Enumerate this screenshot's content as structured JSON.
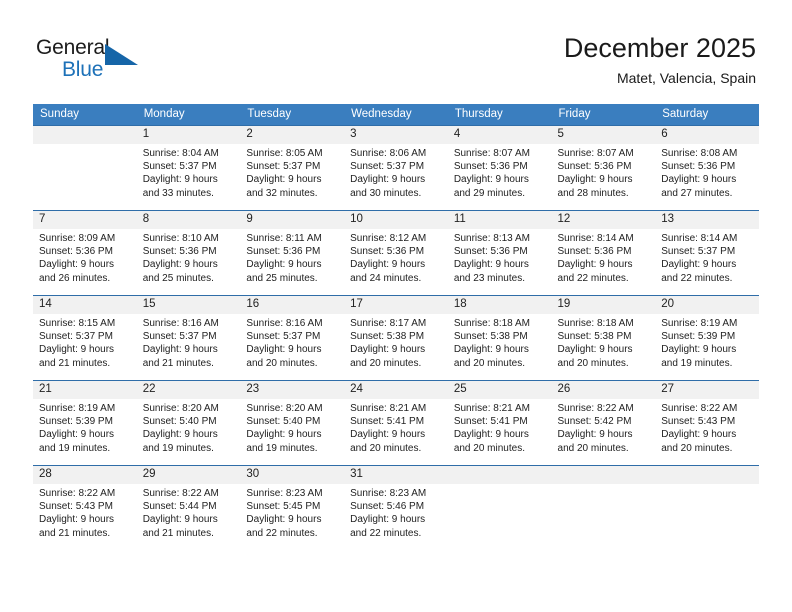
{
  "brand": {
    "name_part1": "General",
    "name_part2": "Blue",
    "logo_icon": "triangle-logo-icon"
  },
  "header": {
    "title": "December 2025",
    "subtitle": "Matet, Valencia, Spain"
  },
  "colors": {
    "header_blue": "#3a7ebf",
    "rule_blue": "#2f6da8",
    "daynum_bg": "#f1f1f1",
    "brand_blue": "#1d71b8"
  },
  "calendar": {
    "weekday_headers": [
      "Sunday",
      "Monday",
      "Tuesday",
      "Wednesday",
      "Thursday",
      "Friday",
      "Saturday"
    ],
    "weeks": [
      [
        {
          "day": "",
          "sunrise": "",
          "sunset": "",
          "daylight_line1": "",
          "daylight_line2": ""
        },
        {
          "day": "1",
          "sunrise": "Sunrise: 8:04 AM",
          "sunset": "Sunset: 5:37 PM",
          "daylight_line1": "Daylight: 9 hours",
          "daylight_line2": "and 33 minutes."
        },
        {
          "day": "2",
          "sunrise": "Sunrise: 8:05 AM",
          "sunset": "Sunset: 5:37 PM",
          "daylight_line1": "Daylight: 9 hours",
          "daylight_line2": "and 32 minutes."
        },
        {
          "day": "3",
          "sunrise": "Sunrise: 8:06 AM",
          "sunset": "Sunset: 5:37 PM",
          "daylight_line1": "Daylight: 9 hours",
          "daylight_line2": "and 30 minutes."
        },
        {
          "day": "4",
          "sunrise": "Sunrise: 8:07 AM",
          "sunset": "Sunset: 5:36 PM",
          "daylight_line1": "Daylight: 9 hours",
          "daylight_line2": "and 29 minutes."
        },
        {
          "day": "5",
          "sunrise": "Sunrise: 8:07 AM",
          "sunset": "Sunset: 5:36 PM",
          "daylight_line1": "Daylight: 9 hours",
          "daylight_line2": "and 28 minutes."
        },
        {
          "day": "6",
          "sunrise": "Sunrise: 8:08 AM",
          "sunset": "Sunset: 5:36 PM",
          "daylight_line1": "Daylight: 9 hours",
          "daylight_line2": "and 27 minutes."
        }
      ],
      [
        {
          "day": "7",
          "sunrise": "Sunrise: 8:09 AM",
          "sunset": "Sunset: 5:36 PM",
          "daylight_line1": "Daylight: 9 hours",
          "daylight_line2": "and 26 minutes."
        },
        {
          "day": "8",
          "sunrise": "Sunrise: 8:10 AM",
          "sunset": "Sunset: 5:36 PM",
          "daylight_line1": "Daylight: 9 hours",
          "daylight_line2": "and 25 minutes."
        },
        {
          "day": "9",
          "sunrise": "Sunrise: 8:11 AM",
          "sunset": "Sunset: 5:36 PM",
          "daylight_line1": "Daylight: 9 hours",
          "daylight_line2": "and 25 minutes."
        },
        {
          "day": "10",
          "sunrise": "Sunrise: 8:12 AM",
          "sunset": "Sunset: 5:36 PM",
          "daylight_line1": "Daylight: 9 hours",
          "daylight_line2": "and 24 minutes."
        },
        {
          "day": "11",
          "sunrise": "Sunrise: 8:13 AM",
          "sunset": "Sunset: 5:36 PM",
          "daylight_line1": "Daylight: 9 hours",
          "daylight_line2": "and 23 minutes."
        },
        {
          "day": "12",
          "sunrise": "Sunrise: 8:14 AM",
          "sunset": "Sunset: 5:36 PM",
          "daylight_line1": "Daylight: 9 hours",
          "daylight_line2": "and 22 minutes."
        },
        {
          "day": "13",
          "sunrise": "Sunrise: 8:14 AM",
          "sunset": "Sunset: 5:37 PM",
          "daylight_line1": "Daylight: 9 hours",
          "daylight_line2": "and 22 minutes."
        }
      ],
      [
        {
          "day": "14",
          "sunrise": "Sunrise: 8:15 AM",
          "sunset": "Sunset: 5:37 PM",
          "daylight_line1": "Daylight: 9 hours",
          "daylight_line2": "and 21 minutes."
        },
        {
          "day": "15",
          "sunrise": "Sunrise: 8:16 AM",
          "sunset": "Sunset: 5:37 PM",
          "daylight_line1": "Daylight: 9 hours",
          "daylight_line2": "and 21 minutes."
        },
        {
          "day": "16",
          "sunrise": "Sunrise: 8:16 AM",
          "sunset": "Sunset: 5:37 PM",
          "daylight_line1": "Daylight: 9 hours",
          "daylight_line2": "and 20 minutes."
        },
        {
          "day": "17",
          "sunrise": "Sunrise: 8:17 AM",
          "sunset": "Sunset: 5:38 PM",
          "daylight_line1": "Daylight: 9 hours",
          "daylight_line2": "and 20 minutes."
        },
        {
          "day": "18",
          "sunrise": "Sunrise: 8:18 AM",
          "sunset": "Sunset: 5:38 PM",
          "daylight_line1": "Daylight: 9 hours",
          "daylight_line2": "and 20 minutes."
        },
        {
          "day": "19",
          "sunrise": "Sunrise: 8:18 AM",
          "sunset": "Sunset: 5:38 PM",
          "daylight_line1": "Daylight: 9 hours",
          "daylight_line2": "and 20 minutes."
        },
        {
          "day": "20",
          "sunrise": "Sunrise: 8:19 AM",
          "sunset": "Sunset: 5:39 PM",
          "daylight_line1": "Daylight: 9 hours",
          "daylight_line2": "and 19 minutes."
        }
      ],
      [
        {
          "day": "21",
          "sunrise": "Sunrise: 8:19 AM",
          "sunset": "Sunset: 5:39 PM",
          "daylight_line1": "Daylight: 9 hours",
          "daylight_line2": "and 19 minutes."
        },
        {
          "day": "22",
          "sunrise": "Sunrise: 8:20 AM",
          "sunset": "Sunset: 5:40 PM",
          "daylight_line1": "Daylight: 9 hours",
          "daylight_line2": "and 19 minutes."
        },
        {
          "day": "23",
          "sunrise": "Sunrise: 8:20 AM",
          "sunset": "Sunset: 5:40 PM",
          "daylight_line1": "Daylight: 9 hours",
          "daylight_line2": "and 19 minutes."
        },
        {
          "day": "24",
          "sunrise": "Sunrise: 8:21 AM",
          "sunset": "Sunset: 5:41 PM",
          "daylight_line1": "Daylight: 9 hours",
          "daylight_line2": "and 20 minutes."
        },
        {
          "day": "25",
          "sunrise": "Sunrise: 8:21 AM",
          "sunset": "Sunset: 5:41 PM",
          "daylight_line1": "Daylight: 9 hours",
          "daylight_line2": "and 20 minutes."
        },
        {
          "day": "26",
          "sunrise": "Sunrise: 8:22 AM",
          "sunset": "Sunset: 5:42 PM",
          "daylight_line1": "Daylight: 9 hours",
          "daylight_line2": "and 20 minutes."
        },
        {
          "day": "27",
          "sunrise": "Sunrise: 8:22 AM",
          "sunset": "Sunset: 5:43 PM",
          "daylight_line1": "Daylight: 9 hours",
          "daylight_line2": "and 20 minutes."
        }
      ],
      [
        {
          "day": "28",
          "sunrise": "Sunrise: 8:22 AM",
          "sunset": "Sunset: 5:43 PM",
          "daylight_line1": "Daylight: 9 hours",
          "daylight_line2": "and 21 minutes."
        },
        {
          "day": "29",
          "sunrise": "Sunrise: 8:22 AM",
          "sunset": "Sunset: 5:44 PM",
          "daylight_line1": "Daylight: 9 hours",
          "daylight_line2": "and 21 minutes."
        },
        {
          "day": "30",
          "sunrise": "Sunrise: 8:23 AM",
          "sunset": "Sunset: 5:45 PM",
          "daylight_line1": "Daylight: 9 hours",
          "daylight_line2": "and 22 minutes."
        },
        {
          "day": "31",
          "sunrise": "Sunrise: 8:23 AM",
          "sunset": "Sunset: 5:46 PM",
          "daylight_line1": "Daylight: 9 hours",
          "daylight_line2": "and 22 minutes."
        },
        {
          "day": "",
          "sunrise": "",
          "sunset": "",
          "daylight_line1": "",
          "daylight_line2": ""
        },
        {
          "day": "",
          "sunrise": "",
          "sunset": "",
          "daylight_line1": "",
          "daylight_line2": ""
        },
        {
          "day": "",
          "sunrise": "",
          "sunset": "",
          "daylight_line1": "",
          "daylight_line2": ""
        }
      ]
    ]
  }
}
